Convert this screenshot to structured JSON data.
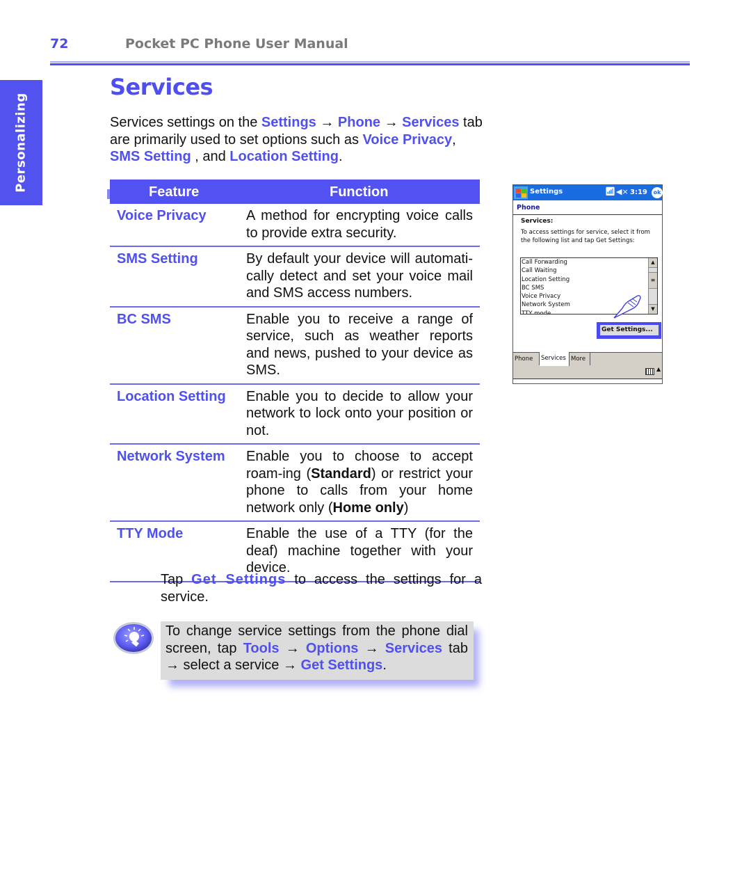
{
  "header": {
    "page_number": "72",
    "manual_title": "Pocket PC Phone User Manual"
  },
  "side_tab": {
    "label": "Personalizing"
  },
  "section": {
    "title": "Services",
    "intro": {
      "t1": "Services settings on the ",
      "settings": "Settings",
      "arrow1": " → ",
      "phone": "Phone",
      "arrow2": " → ",
      "services": "Services",
      "t2": " tab are primarily used to set options such as ",
      "voice_privacy": "Voice Privacy",
      "t3": ", ",
      "sms_setting": "SMS Setting",
      "t4": " , and ",
      "location_setting": "Location Setting",
      "t5": "."
    }
  },
  "table": {
    "headers": {
      "feature": "Feature",
      "function": "Function"
    },
    "rows": [
      {
        "feature": "Voice Privacy",
        "function": "A method for encrypting voice calls to provide extra security."
      },
      {
        "feature": "SMS Setting",
        "function": "By default your device will automati-cally detect and set your voice mail and SMS access numbers."
      },
      {
        "feature": "BC SMS",
        "function": "Enable you to receive a range of service, such as weather reports and news, pushed to your device as SMS."
      },
      {
        "feature": "Location Setting",
        "function": "Enable you to decide to allow your network to lock onto your position or not."
      },
      {
        "feature": "Network System",
        "function_parts": {
          "a": "Enable you to choose to accept roam-ing (",
          "b": "Standard",
          "c": ") or restrict your phone to calls from your home network only (",
          "d": "Home only",
          "e": ")"
        }
      },
      {
        "feature": "TTY Mode",
        "function": "Enable the use of a TTY (for the deaf) machine together with your device."
      }
    ]
  },
  "tap_text": {
    "t1": "Tap ",
    "get_settings": "Get Settings",
    "t2": " to access the settings for a service."
  },
  "tip": {
    "icon": "lightbulb-icon",
    "t1": "To change service settings from the phone dial screen, tap ",
    "tools": "Tools",
    "arrow1": " → ",
    "options": "Options",
    "arrow2": " → ",
    "services": "Services",
    "t2": " tab → select a service → ",
    "get_settings": "Get Settings",
    "t3": "."
  },
  "phone_screen": {
    "app_title": "Settings",
    "time": "3:19",
    "ok_label": "ok",
    "signal_icon": "antenna-icon",
    "volume_icon": "speaker-muted-icon",
    "heading": "Phone",
    "services_label": "Services:",
    "description": "To access settings for service, select it from the following list and tap Get Settings:",
    "list_items": [
      "Call Forwarding",
      "Call Waiting",
      "Location Setting",
      "BC SMS",
      "Voice Privacy",
      "Network System",
      "TTY mode"
    ],
    "get_settings_button": "Get Settings...",
    "tabs": [
      "Phone",
      "Services",
      "More"
    ],
    "active_tab": "Services",
    "colors": {
      "titlebar": "#1a6de0",
      "highlight": "#4a4af0"
    }
  },
  "colors": {
    "accent": "#5050f0",
    "tip_bg": "#dcdcdc"
  }
}
